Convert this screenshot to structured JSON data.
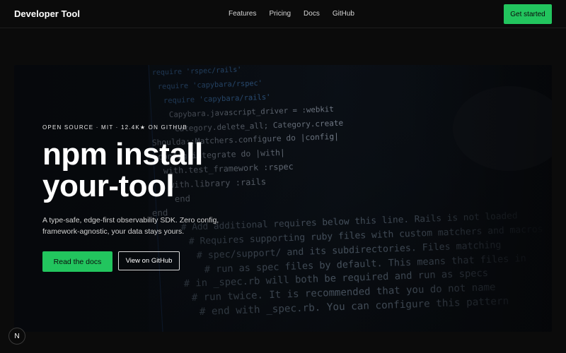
{
  "header": {
    "brand": "Developer Tool",
    "nav": [
      "Features",
      "Pricing",
      "Docs",
      "GitHub"
    ],
    "cta_label": "Get started"
  },
  "hero": {
    "eyebrow": "OPEN SOURCE · MIT · 12.4K★ ON GITHUB",
    "headline_line1": "npm install",
    "headline_line2": "your-tool",
    "subtitle": "A type-safe, edge-first observability SDK. Zero config, framework-agnostic, your data stays yours.",
    "primary_button": "Read the docs",
    "secondary_button": "View on GitHub",
    "background_code": [
      "require 'rspec/rails'",
      "require 'capybara/rspec'",
      "require 'capybara/rails'",
      "Capybara.javascript_driver = :webkit",
      "Category.delete_all; Category.create",
      "Shoulda::Matchers.configure do |config|",
      "config.integrate do |with|",
      "with.test_framework :rspec",
      "with.library :rails",
      "end",
      "end",
      "# Add additional requires below this line. Rails is not loaded",
      "# Requires supporting ruby files with custom matchers and macros",
      "# spec/support/ and its subdirectories. Files matching",
      "# run as spec files by default. This means that files in",
      "# in _spec.rb will both be required and run as specs",
      "# run twice. It is recommended that you do not name",
      "# end with _spec.rb. You can configure this pattern"
    ]
  },
  "overlay": {
    "badge": "N"
  },
  "colors": {
    "accent": "#22c55e",
    "background": "#0a0a0a",
    "code_keyword": "#5aa9ff",
    "code_string": "#d9d35b",
    "code_comment": "#8fa3b8"
  }
}
